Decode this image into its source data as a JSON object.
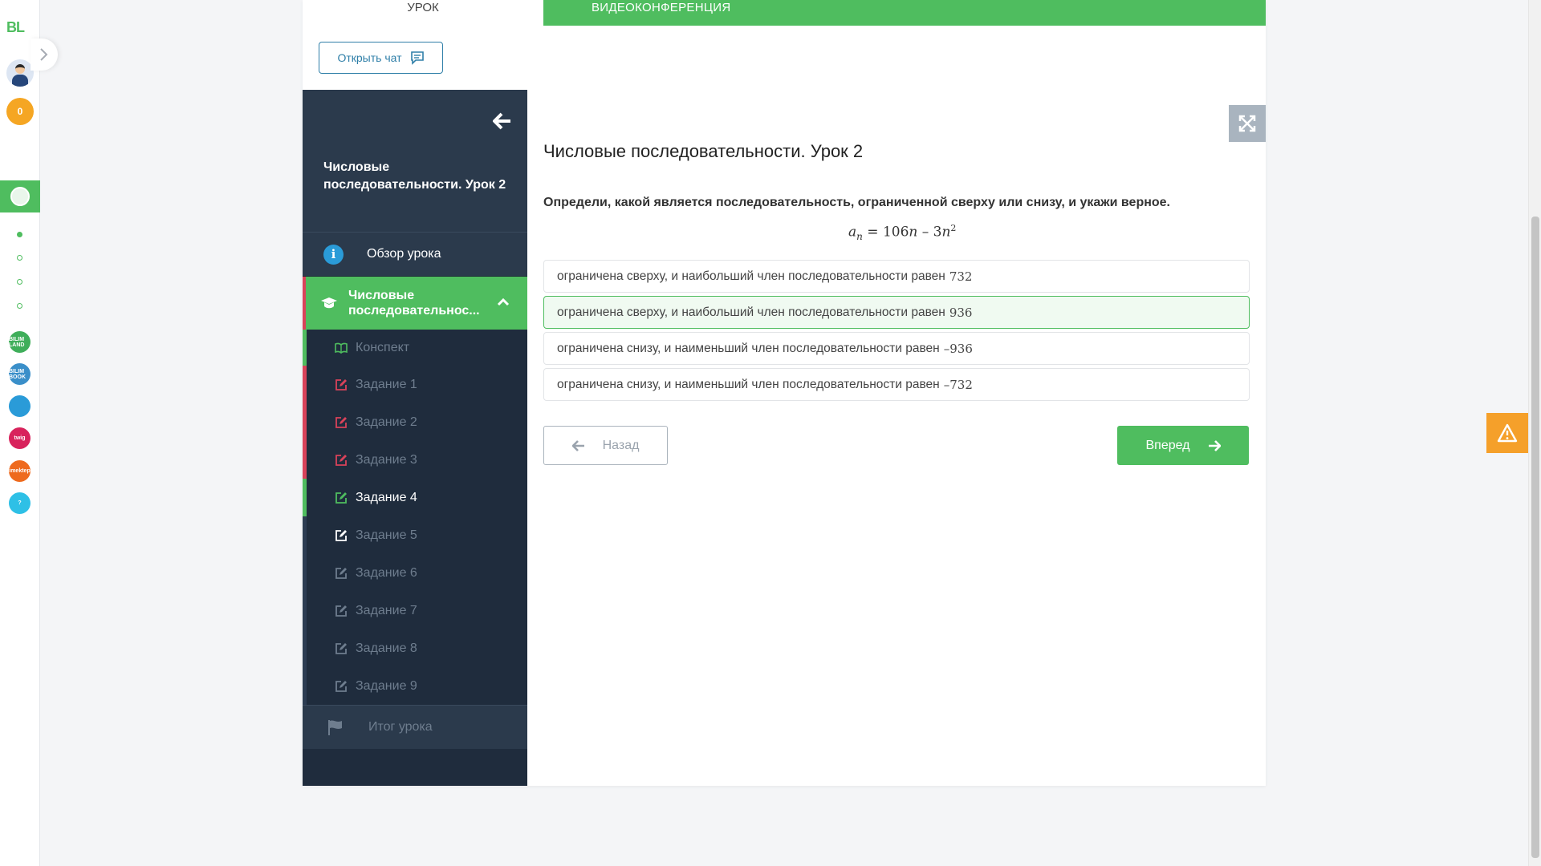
{
  "rail": {
    "logo": "BL",
    "points": "0",
    "apps": [
      {
        "icon": "online-mektep-icon",
        "color": "#4fbd5f",
        "label": "ONLINE MEKTEP"
      },
      {
        "icon": "bilim-land-icon",
        "color": "#3fae5a",
        "label": "BILIM LAND"
      },
      {
        "icon": "bilim-book-icon",
        "color": "#3a8fc9",
        "label": "BILIM BOOK"
      },
      {
        "icon": "checklist-icon",
        "color": "#2a9bd8",
        "label": ""
      },
      {
        "icon": "twig-icon",
        "color": "#d8235c",
        "label": "twig"
      },
      {
        "icon": "imektep-icon",
        "color": "#ee6a1e",
        "label": "imektep"
      },
      {
        "icon": "help-icon",
        "color": "#2ec0e6",
        "label": "?"
      }
    ]
  },
  "tabs": {
    "lesson": "УРОК",
    "video": "ВИДЕОКОНФЕРЕНЦИЯ"
  },
  "chat_button": "Открыть чат",
  "sidebar": {
    "title": "Числовые последовательности. Урок 2",
    "overview": "Обзор урока",
    "section": "Числовые последовательнос...",
    "items": [
      {
        "label": "Конспект",
        "state": "konspekt",
        "icon": "book-icon"
      },
      {
        "label": "Задание 1",
        "state": "red",
        "icon": "edit-icon"
      },
      {
        "label": "Задание 2",
        "state": "red",
        "icon": "edit-icon"
      },
      {
        "label": "Задание 3",
        "state": "red",
        "icon": "edit-icon"
      },
      {
        "label": "Задание 4",
        "state": "green",
        "icon": "edit-icon"
      },
      {
        "label": "Задание 5",
        "state": "current",
        "icon": "edit-icon"
      },
      {
        "label": "Задание 6",
        "state": "none",
        "icon": "edit-icon"
      },
      {
        "label": "Задание 7",
        "state": "none",
        "icon": "edit-icon"
      },
      {
        "label": "Задание 8",
        "state": "none",
        "icon": "edit-icon"
      },
      {
        "label": "Задание 9",
        "state": "none",
        "icon": "edit-icon"
      }
    ],
    "result": "Итог урока"
  },
  "content": {
    "title": "Числовые последовательности. Урок 2",
    "question": "Определи, какой является последовательность, ограниченной сверху или снизу, и укажи верное.",
    "formula": {
      "lhs": "a",
      "lhs_sub": "n",
      "rhs_coef": "106",
      "rhs_var": "n",
      "rhs_op": " – 3",
      "rhs_var2": "n",
      "rhs_exp": "2"
    },
    "answers": [
      {
        "text": "ограничена сверху, и наибольший член последовательности равен",
        "value": "732",
        "selected": false
      },
      {
        "text": "ограничена сверху, и наибольший член последовательности равен",
        "value": "936",
        "selected": true
      },
      {
        "text": "ограничена снизу, и наименьший член последовательности равен",
        "value": "–936",
        "selected": false
      },
      {
        "text": "ограничена снизу, и наименьший член последовательности равен",
        "value": "–732",
        "selected": false
      }
    ],
    "back": "Назад",
    "next": "Вперед"
  },
  "colors": {
    "accent": "#4fbd5f",
    "sidebar": "#1f2c3d",
    "error": "#d9425a",
    "warning": "#f5a02a"
  }
}
